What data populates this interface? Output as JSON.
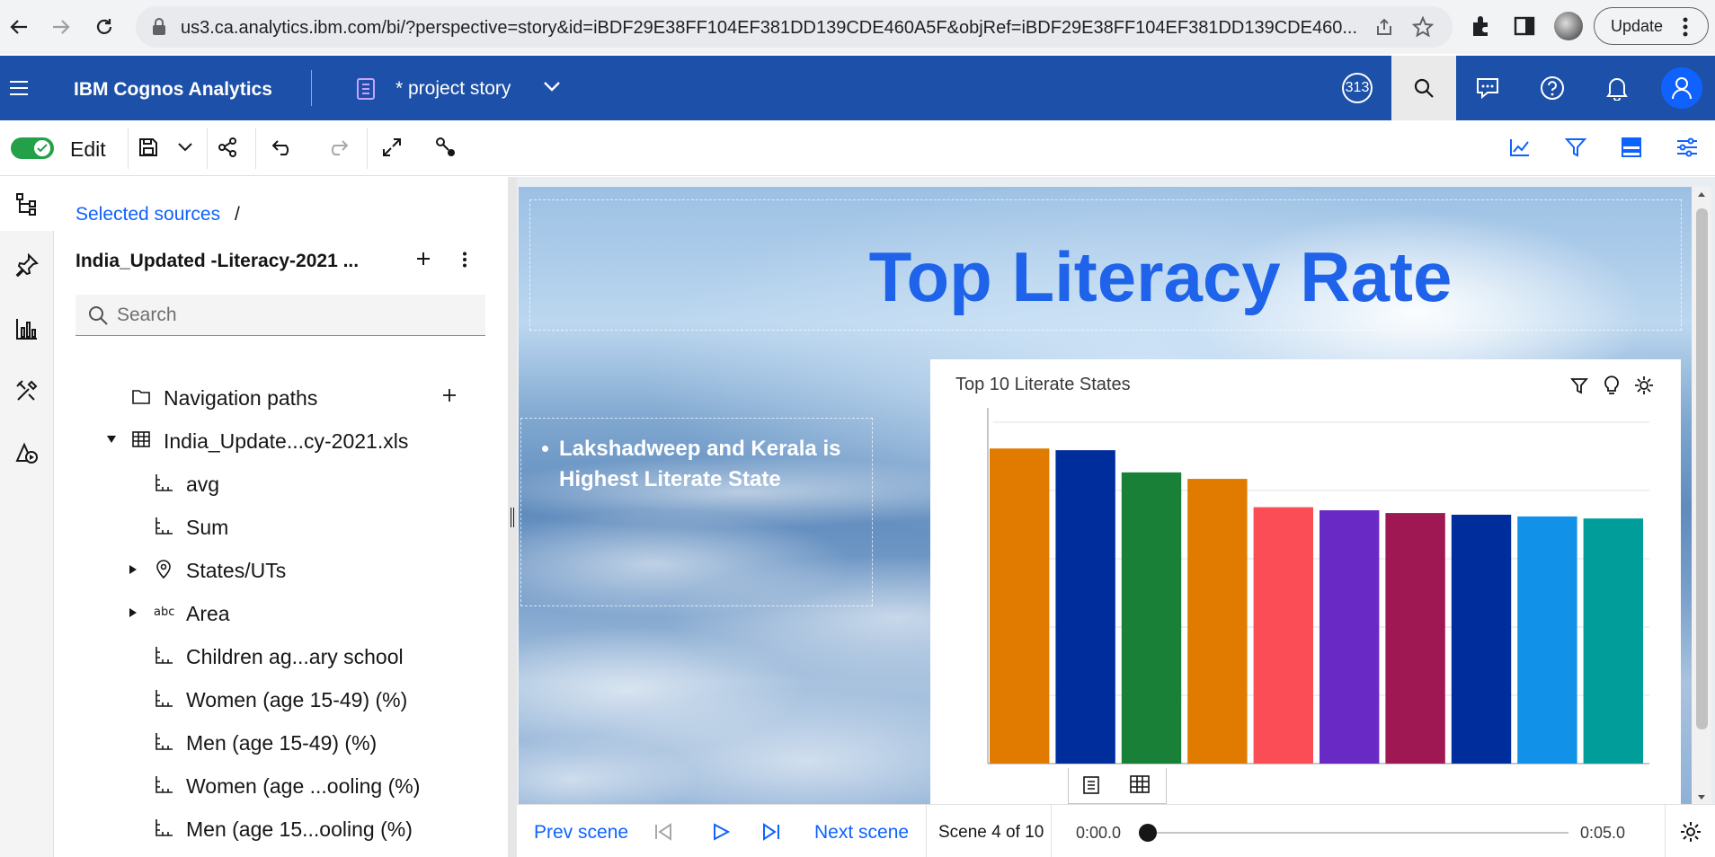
{
  "browser": {
    "url": "us3.ca.analytics.ibm.com/bi/?perspective=story&id=iBDF29E38FF104EF381DD139CDE460A5F&objRef=iBDF29E38FF104EF381DD139CDE460...",
    "update_label": "Update"
  },
  "app_header": {
    "app_name": "IBM Cognos Analytics",
    "story_title": "* project story",
    "badge_text": "313"
  },
  "toolbar": {
    "edit_label": "Edit"
  },
  "source_panel": {
    "breadcrumb": "Selected sources",
    "breadcrumb_sep": "/",
    "source_name": "India_Updated -Literacy-2021 ...",
    "search_placeholder": "Search",
    "tree": [
      {
        "label": "Navigation paths",
        "icon": "folder-icon",
        "expandable": false,
        "indent": 1
      },
      {
        "label": "India_Update...cy-2021.xls",
        "icon": "table-icon",
        "expandable": true,
        "expanded": true,
        "indent": 1
      },
      {
        "label": "avg",
        "icon": "measure-icon",
        "expandable": false,
        "indent": 2
      },
      {
        "label": "Sum",
        "icon": "measure-icon",
        "expandable": false,
        "indent": 2
      },
      {
        "label": "States/UTs",
        "icon": "location-icon",
        "expandable": true,
        "expanded": false,
        "indent": 2
      },
      {
        "label": "Area",
        "icon": "abc-icon",
        "expandable": true,
        "expanded": false,
        "indent": 2
      },
      {
        "label": "Children ag...ary school",
        "icon": "measure-icon",
        "expandable": false,
        "indent": 2
      },
      {
        "label": "Women (age 15-49) (%)",
        "icon": "measure-icon",
        "expandable": false,
        "indent": 2
      },
      {
        "label": "Men (age 15-49) (%)",
        "icon": "measure-icon",
        "expandable": false,
        "indent": 2
      },
      {
        "label": "Women (age ...ooling (%)",
        "icon": "measure-icon",
        "expandable": false,
        "indent": 2
      },
      {
        "label": "Men (age 15...ooling (%)",
        "icon": "measure-icon",
        "expandable": false,
        "indent": 2
      }
    ],
    "abc_glyph": "abc"
  },
  "scene": {
    "heading": "Top Literacy Rate",
    "bullet": "Lakshadweep and Kerala is Highest Literate State"
  },
  "chart_data": {
    "type": "bar",
    "title": "Top 10 Literate States",
    "categories": [],
    "values": [
      92.3,
      91.8,
      85.3,
      83.4,
      75.1,
      74.2,
      73.4,
      72.9,
      72.4,
      71.8
    ],
    "colors": [
      "#e07b00",
      "#002d9c",
      "#198038",
      "#e07b00",
      "#fa4d56",
      "#6929c4",
      "#9f1853",
      "#002d9c",
      "#1192e8",
      "#009d9a"
    ],
    "ylim": [
      0,
      100
    ],
    "grid": true,
    "legend": "none"
  },
  "player": {
    "prev_label": "Prev scene",
    "next_label": "Next scene",
    "scene_counter": "Scene 4 of 10",
    "time_start": "0:00.0",
    "time_end": "0:05.0",
    "progress": 0
  },
  "colors": {
    "header_blue": "#1d50a8",
    "link_blue": "#0f62fe",
    "toggle_green": "#24a148"
  }
}
